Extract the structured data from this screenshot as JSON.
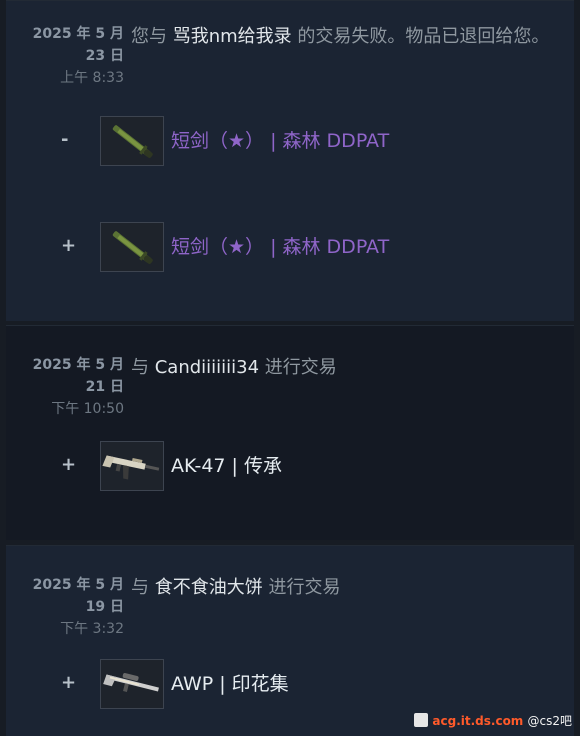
{
  "entries": [
    {
      "date": "2025 年 5 月",
      "day": "23 日",
      "time": "上午 8:33",
      "desc_pre": "您与 ",
      "partner": "骂我nm给我录",
      "desc_post": " 的交易失败。物品已退回给您。",
      "items": [
        {
          "sign": "-",
          "name": "短剑（★） | 森林 DDPAT",
          "name_color": "#8f65c9",
          "icon": "knife-icon"
        },
        {
          "sign": "+",
          "name": "短剑（★） | 森林 DDPAT",
          "name_color": "#8f65c9",
          "icon": "knife-icon"
        }
      ]
    },
    {
      "date": "2025 年 5 月",
      "day": "21 日",
      "time": "下午 10:50",
      "desc_pre": "与 ",
      "partner": "Candiiiiiii34",
      "desc_post": " 进行交易",
      "items": [
        {
          "sign": "+",
          "name": "AK-47 | 传承",
          "icon": "rifle-icon"
        }
      ]
    },
    {
      "date": "2025 年 5 月",
      "day": "19 日",
      "time": "下午 3:32",
      "desc_pre": "与 ",
      "partner": "食不食油大饼",
      "desc_post": " 进行交易",
      "items": [
        {
          "sign": "+",
          "name": "AWP | 印花集",
          "icon": "sniper-icon"
        }
      ]
    }
  ],
  "watermark": {
    "site": "acg.it.ds.com",
    "tieba": "@cs2吧"
  }
}
